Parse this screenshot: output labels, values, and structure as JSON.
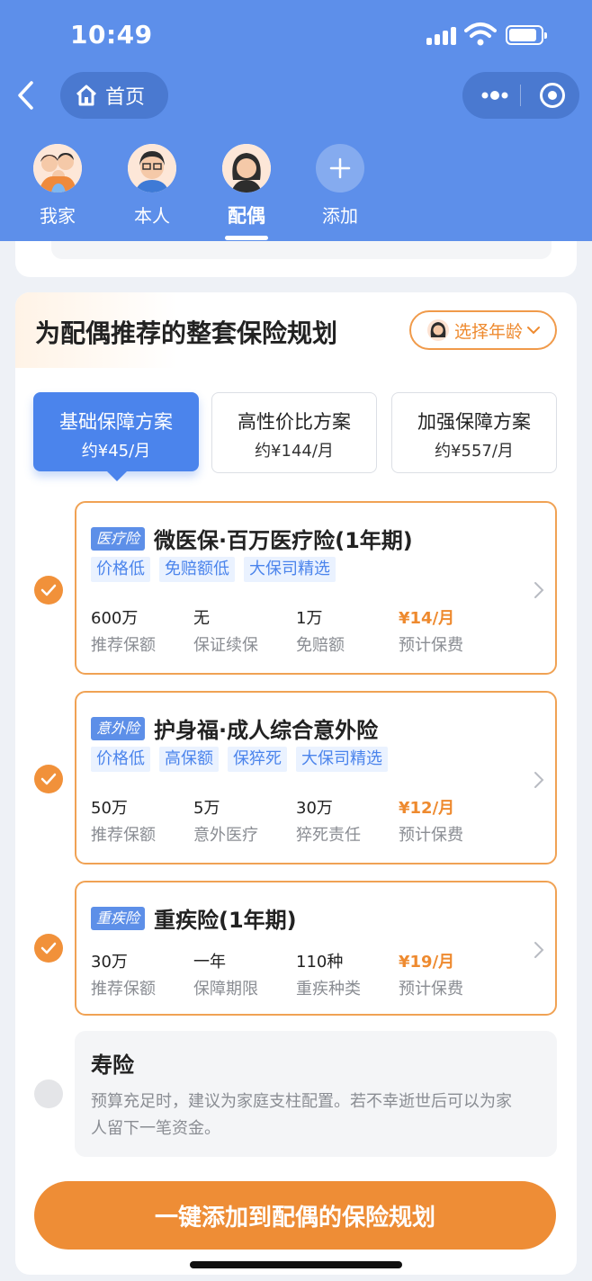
{
  "status_bar": {
    "time": "10:49"
  },
  "nav": {
    "home_label": "首页"
  },
  "members": [
    {
      "label": "我家"
    },
    {
      "label": "本人"
    },
    {
      "label": "配偶",
      "active": true
    },
    {
      "label": "添加"
    }
  ],
  "main": {
    "title": "为配偶推荐的整套保险规划",
    "age_button": "选择年龄"
  },
  "plans": [
    {
      "name": "基础保障方案",
      "price": "约¥45/月",
      "active": true
    },
    {
      "name": "高性价比方案",
      "price": "约¥144/月"
    },
    {
      "name": "加强保障方案",
      "price": "约¥557/月"
    }
  ],
  "products": [
    {
      "badge": "医疗险",
      "name": "微医保·百万医疗险(1年期)",
      "tags": [
        "价格低",
        "免赔额低",
        "大保司精选"
      ],
      "stats": [
        {
          "value": "600万",
          "label": "推荐保额"
        },
        {
          "value": "无",
          "label": "保证续保"
        },
        {
          "value": "1万",
          "label": "免赔额"
        },
        {
          "value": "¥14/月",
          "label": "预计保费"
        }
      ],
      "checked": true
    },
    {
      "badge": "意外险",
      "name": "护身福·成人综合意外险",
      "tags": [
        "价格低",
        "高保额",
        "保猝死",
        "大保司精选"
      ],
      "stats": [
        {
          "value": "50万",
          "label": "推荐保额"
        },
        {
          "value": "5万",
          "label": "意外医疗"
        },
        {
          "value": "30万",
          "label": "猝死责任"
        },
        {
          "value": "¥12/月",
          "label": "预计保费"
        }
      ],
      "checked": true
    },
    {
      "badge": "重疾险",
      "name": "重疾险(1年期)",
      "tags": [],
      "stats": [
        {
          "value": "30万",
          "label": "推荐保额"
        },
        {
          "value": "一年",
          "label": "保障期限"
        },
        {
          "value": "110种",
          "label": "重疾种类"
        },
        {
          "value": "¥19/月",
          "label": "预计保费"
        }
      ],
      "checked": true
    }
  ],
  "life": {
    "title": "寿险",
    "desc": "预算充足时，建议为家庭支柱配置。若不幸逝世后可以为家人留下一笔资金。",
    "checked": false
  },
  "cta": {
    "label": "一键添加到配偶的保险规划"
  },
  "colors": {
    "header": "#5d8fea",
    "accent": "#ee8d36",
    "primary": "#4b84ec"
  }
}
